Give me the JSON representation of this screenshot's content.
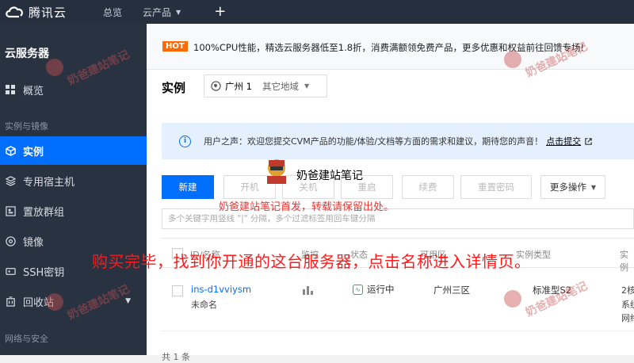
{
  "topbar": {
    "logo_text": "腾讯云",
    "nav_overview": "总览",
    "nav_products": "云产品",
    "plus": "+"
  },
  "sidebar": {
    "title": "云服务器",
    "items": [
      {
        "label": "概览",
        "icon": "grid-icon"
      },
      {
        "label": "实例",
        "icon": "cube-icon",
        "active": true
      },
      {
        "label": "专用宿主机",
        "icon": "layers-icon"
      },
      {
        "label": "置放群组",
        "icon": "group-icon"
      },
      {
        "label": "镜像",
        "icon": "disc-icon"
      },
      {
        "label": "SSH密钥",
        "icon": "key-icon"
      },
      {
        "label": "回收站",
        "icon": "trash-icon"
      }
    ],
    "section_instances": "实例与镜像",
    "section_network": "网络与安全"
  },
  "hotbar": {
    "badge": "HOT",
    "text": "100%CPU性能，精选云服务器低至1.8折，消费满额领免费产品，更多优惠和权益前往回馈专场!"
  },
  "page": {
    "title": "实例",
    "region_current": "广州 1",
    "region_other": "其它地域"
  },
  "notice": {
    "text": "用户之声：欢迎您提交CVM产品的功能/体验/文档等方面的需求和建议，期待您的声音！",
    "link": "点击提交"
  },
  "toolbar": {
    "new": "新建",
    "start": "开机",
    "stop": "关机",
    "restart": "重启",
    "renew": "续费",
    "reset_password": "重置密码",
    "more": "更多操作"
  },
  "search": {
    "placeholder": "多个关键字用竖线 \"|\" 分隔，多个过滤标签用回车键分隔"
  },
  "table": {
    "headers": [
      "ID/名称",
      "监控",
      "状态",
      "可用区",
      "实例类型",
      "实例"
    ],
    "rows": [
      {
        "id": "ins-d1vviysm",
        "name": "未命名",
        "status": "运行中",
        "zone": "广州三区",
        "type": "标准型S2",
        "config": [
          "2核",
          "系统",
          "网络"
        ]
      }
    ],
    "total": "共 1 条"
  },
  "overlay": {
    "brand": "奶爸建站笔记",
    "repost_note": "奶爸建站笔记首发，转载请保留出处。",
    "instruction": "购买完毕，找到你开通的这台服务器，点击名称进入详情页。",
    "watermark": "奶爸建站笔记"
  },
  "colors": {
    "accent": "#006eff",
    "topbar": "#262f3e",
    "sidebar": "#293241",
    "hot": "#ff6a00",
    "running": "#0abf5b",
    "annotation": "#ff1a1a"
  }
}
